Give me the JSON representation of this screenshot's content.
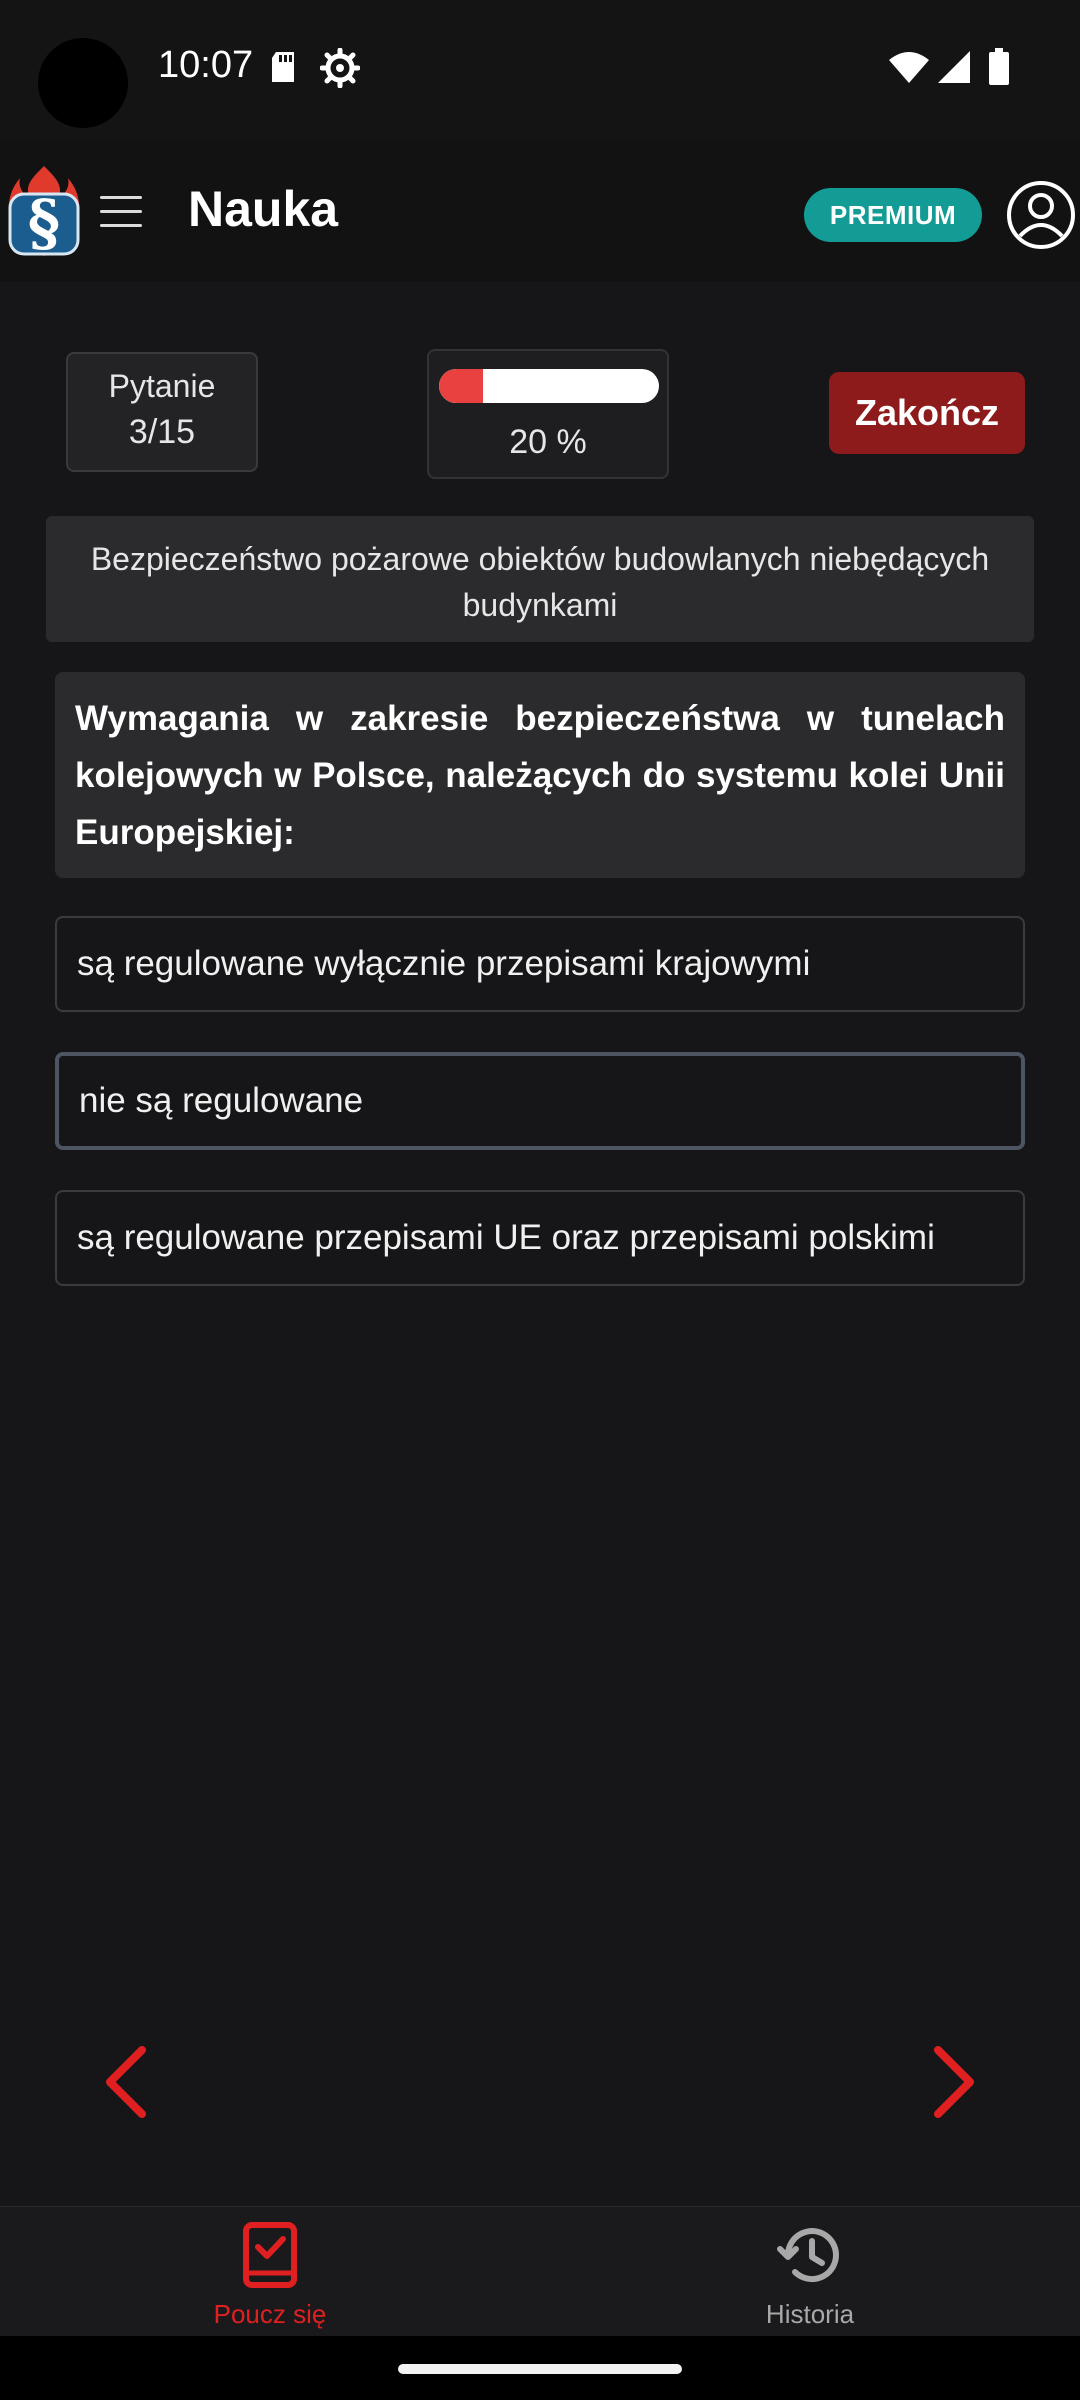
{
  "status_bar": {
    "time": "10:07",
    "icons": [
      "sd-card-icon",
      "gear-icon",
      "wifi-icon",
      "signal-icon",
      "battery-icon"
    ]
  },
  "app_bar": {
    "title": "Nauka",
    "premium_badge": "PREMIUM",
    "logo_icon": "paragraph-flame-logo",
    "menu_icon": "hamburger-menu-icon",
    "profile_icon": "user-profile-icon"
  },
  "quiz_header": {
    "question_label": "Pytanie",
    "question_counter": "3/15",
    "progress_percent": 20,
    "progress_text": "20 %",
    "finish_label": "Zakończ"
  },
  "category": "Bezpieczeństwo pożarowe obiektów budowlanych niebędących budynkami",
  "question": "Wymagania w zakresie bezpieczeństwa w tunelach kolejowych w Polsce, należących do systemu kolei Unii Europejskiej:",
  "answers": [
    {
      "text": "są regulowane wyłącznie przepisami krajowymi",
      "selected": false
    },
    {
      "text": "nie są regulowane",
      "selected": true
    },
    {
      "text": "są regulowane przepisami UE oraz przepisami polskimi",
      "selected": false
    }
  ],
  "navigation": {
    "prev_icon": "chevron-left-icon",
    "next_icon": "chevron-right-icon"
  },
  "bottom_nav": {
    "items": [
      {
        "label": "Poucz się",
        "icon": "book-check-icon",
        "active": true
      },
      {
        "label": "Historia",
        "icon": "history-icon",
        "active": false
      }
    ]
  },
  "colors": {
    "accent_red": "#e02020",
    "premium_teal": "#129c95",
    "finish_button": "#8e1b1b",
    "progress_fill": "#e94040",
    "inactive_nav": "#a8a8a8"
  }
}
